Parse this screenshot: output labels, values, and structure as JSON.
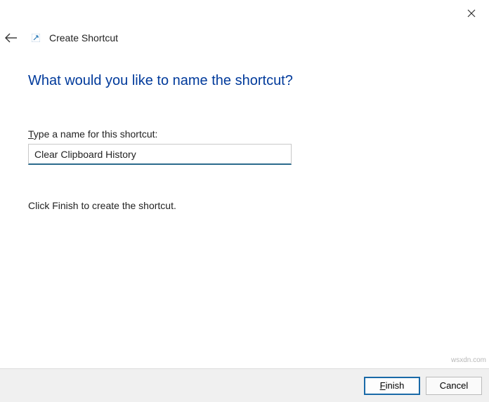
{
  "window": {
    "title": "Create Shortcut"
  },
  "main": {
    "heading": "What would you like to name the shortcut?",
    "field_label_prefix": "T",
    "field_label_rest": "ype a name for this shortcut:",
    "shortcut_name": "Clear Clipboard History",
    "instruction": "Click Finish to create the shortcut."
  },
  "footer": {
    "finish_prefix": "F",
    "finish_rest": "inish",
    "cancel_label": "Cancel"
  },
  "watermark": "wsxdn.com"
}
